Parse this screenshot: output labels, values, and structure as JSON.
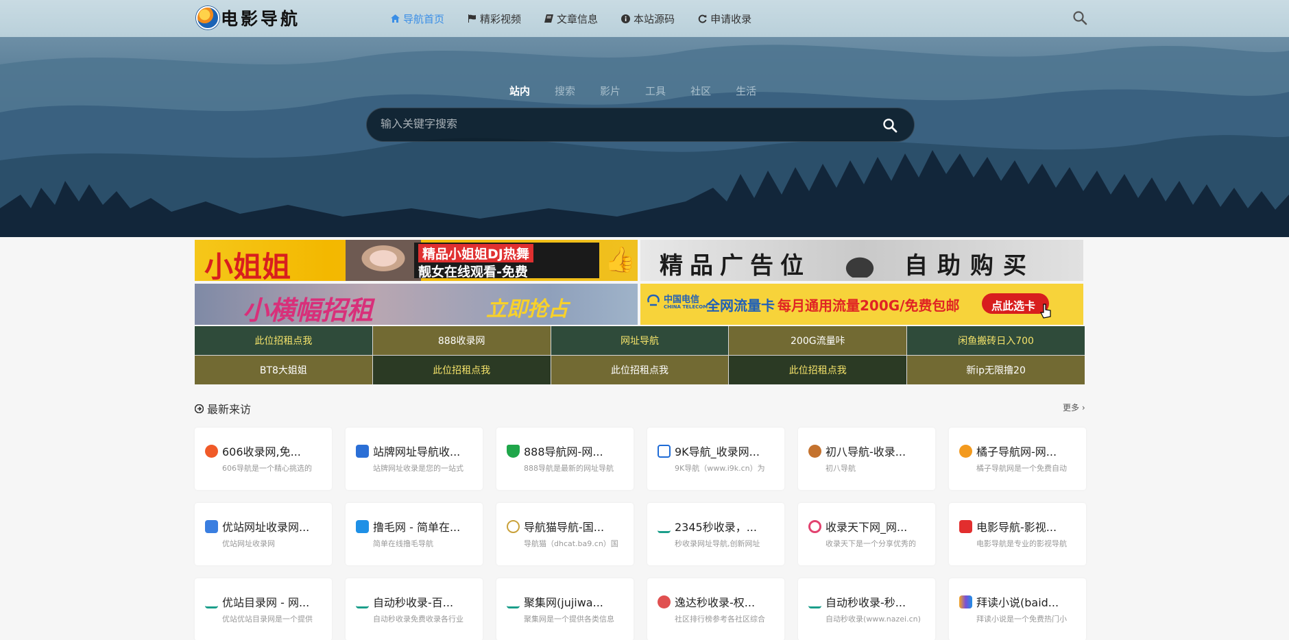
{
  "header": {
    "logo_text": "电影导航",
    "nav": [
      {
        "label": "导航首页",
        "icon": "home-icon",
        "active": true
      },
      {
        "label": "精彩视频",
        "icon": "flag-icon",
        "active": false
      },
      {
        "label": "文章信息",
        "icon": "book-icon",
        "active": false
      },
      {
        "label": "本站源码",
        "icon": "info-icon",
        "active": false
      },
      {
        "label": "申请收录",
        "icon": "refresh-icon",
        "active": false
      }
    ]
  },
  "hero": {
    "tabs": [
      "站内",
      "搜索",
      "影片",
      "工具",
      "社区",
      "生活"
    ],
    "active_tab": "站内",
    "search_placeholder": "输入关键字搜索"
  },
  "ads": {
    "ad1_left": "小姐姐",
    "ad1_line1": "精品小姐姐DJ热舞",
    "ad1_line2": "靓女在线观看-免费",
    "ad2_left": "精品广告位",
    "ad2_right": "自助购买",
    "ad3_left": "小横幅招租",
    "ad3_right": "立即抢占",
    "ad4_brand": "中国电信",
    "ad4_brand_en": "CHINA TELECOM",
    "ad4_text1": "全网流量卡",
    "ad4_text2": "每月通用流量200G/免费包邮",
    "ad4_button": "点此选卡"
  },
  "links": [
    {
      "label": "此位招租点我",
      "bg": "#2f4b3a",
      "color": "#f5e36a"
    },
    {
      "label": "888收录网",
      "bg": "#726a33",
      "color": "#ffffff"
    },
    {
      "label": "网址导航",
      "bg": "#2f4b3a",
      "color": "#f5e36a"
    },
    {
      "label": "200G流量咔",
      "bg": "#726a33",
      "color": "#ffffff"
    },
    {
      "label": "闲鱼搬砖日入700",
      "bg": "#2f4b3a",
      "color": "#f5e36a"
    },
    {
      "label": "BT8大姐姐",
      "bg": "#726a33",
      "color": "#ffffff"
    },
    {
      "label": "此位招租点我",
      "bg": "#2b3a24",
      "color": "#f5e36a"
    },
    {
      "label": "此位招租点我",
      "bg": "#726a33",
      "color": "#ffffff"
    },
    {
      "label": "此位招租点我",
      "bg": "#2b3a24",
      "color": "#f5e36a"
    },
    {
      "label": "新ip无限撸20",
      "bg": "#726a33",
      "color": "#ffffff"
    }
  ],
  "section": {
    "title": "最新来访",
    "more": "更多 ›"
  },
  "cards": [
    {
      "title": "606收录网,免...",
      "desc": "606导航是一个精心挑选的",
      "icon_color": "#f05a28",
      "icon": "606-icon"
    },
    {
      "title": "站牌网址导航收...",
      "desc": "站牌网址收录是您的一站式",
      "icon_color": "#2b6fd6",
      "icon": "cube-icon"
    },
    {
      "title": "888导航网-网...",
      "desc": "888导航是最新的网址导航",
      "icon_color": "#1fa64a",
      "icon": "shield-icon"
    },
    {
      "title": "9K导航_收录网...",
      "desc": "9K导航（www.i9k.cn）为",
      "icon_color": "#1e6bd6",
      "icon": "9k-icon"
    },
    {
      "title": "初八导航-收录...",
      "desc": "初八导航",
      "icon_color": "#c4722e",
      "icon": "mascot-icon"
    },
    {
      "title": "橘子导航网-网...",
      "desc": "橘子导航网是一个免费自动",
      "icon_color": "#f39a1e",
      "icon": "orange-icon"
    },
    {
      "title": "优站网址收录网...",
      "desc": "优站网址收录网",
      "icon_color": "#3a7ee0",
      "icon": "feather-icon"
    },
    {
      "title": "撸毛网 - 简单在...",
      "desc": "简单在线撸毛导航",
      "icon_color": "#1e90e6",
      "icon": "lumao-icon"
    },
    {
      "title": "导航猫导航-国...",
      "desc": "导航猫（dhcat.ba9.cn）国",
      "icon_color": "#c9a13a",
      "icon": "cat-icon"
    },
    {
      "title": "2345秒收录，...",
      "desc": "秒收录网址导航,创新网址",
      "icon_color": "#1a9e8a",
      "icon": "ur-icon"
    },
    {
      "title": "收录天下网_网...",
      "desc": "收录天下是一个分享优秀的",
      "icon_color": "#e2426f",
      "icon": "ring-icon"
    },
    {
      "title": "电影导航-影视...",
      "desc": "电影导航是专业的影视导航",
      "icon_color": "#e22e2e",
      "icon": "play-icon"
    },
    {
      "title": "优站目录网 - 网...",
      "desc": "优站优站目录网是一个提供",
      "icon_color": "#1a9e8a",
      "icon": "ur-icon"
    },
    {
      "title": "自动秒收录-百...",
      "desc": "自动秒收录免费收录各行业",
      "icon_color": "#1a9e8a",
      "icon": "ur-icon"
    },
    {
      "title": "聚集网(jujiwa...",
      "desc": "聚集网是一个提供各类信息",
      "icon_color": "#1a9e8a",
      "icon": "ur-icon"
    },
    {
      "title": "逸达秒收录-权...",
      "desc": "社区排行榜参考各社区综合",
      "icon_color": "#e05050",
      "icon": "heart-icon"
    },
    {
      "title": "自动秒收录-秒...",
      "desc": "自动秒收录(www.nazei.cn)",
      "icon_color": "#1a9e8a",
      "icon": "ur-icon"
    },
    {
      "title": "拜读小说(baid...",
      "desc": "拜读小说是一个免费热门小",
      "icon_color": "#7a4fd6",
      "icon": "rainbow-icon"
    }
  ]
}
